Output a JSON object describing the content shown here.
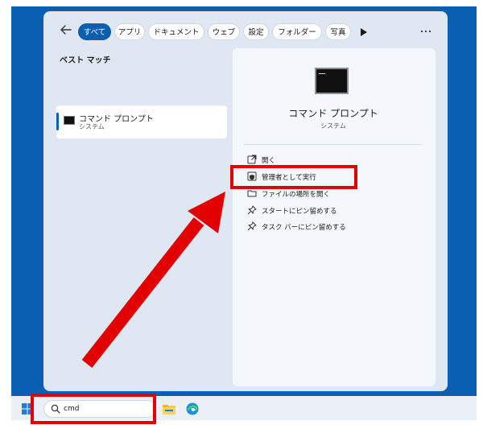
{
  "filters": {
    "tabs": [
      {
        "label": "すべて",
        "active": true
      },
      {
        "label": "アプリ",
        "active": false
      },
      {
        "label": "ドキュメント",
        "active": false
      },
      {
        "label": "ウェブ",
        "active": false
      },
      {
        "label": "設定",
        "active": false
      },
      {
        "label": "フォルダー",
        "active": false
      },
      {
        "label": "写真",
        "active": false
      }
    ]
  },
  "left": {
    "section_title": "ベスト マッチ",
    "best_match": {
      "title": "コマンド プロンプト",
      "subtitle": "システム"
    }
  },
  "detail": {
    "title": "コマンド プロンプト",
    "subtitle": "システム",
    "actions": [
      {
        "label": "開く",
        "icon": "open-external-icon"
      },
      {
        "label": "管理者として実行",
        "icon": "shield-admin-icon"
      },
      {
        "label": "ファイルの場所を開く",
        "icon": "folder-icon"
      },
      {
        "label": "スタートにピン留めする",
        "icon": "pin-icon"
      },
      {
        "label": "タスク バーにピン留めする",
        "icon": "pin-icon"
      }
    ]
  },
  "taskbar": {
    "search_value": "cmd"
  },
  "colors": {
    "accent": "#0b5fb0",
    "annotation": "#e30000"
  }
}
